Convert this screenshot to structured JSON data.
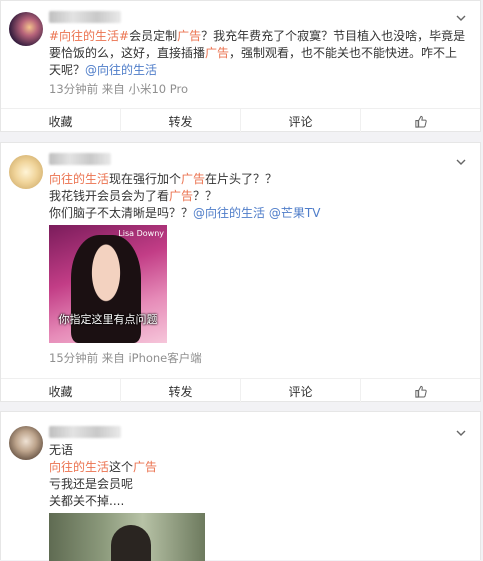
{
  "posts": [
    {
      "lines": [
        [
          [
            "r",
            "#向往的生活#"
          ],
          [
            "t",
            "会员定制"
          ],
          [
            "r",
            "广告"
          ],
          [
            "t",
            "？我充年费充了个寂寞？节目植入也没啥，毕竟是"
          ]
        ],
        [
          [
            "t",
            "要恰饭的么，这好，直接插播"
          ],
          [
            "r",
            "广告"
          ],
          [
            "t",
            "，强制观看，也不能关也不能快进。咋不上"
          ]
        ],
        [
          [
            "t",
            "天呢？"
          ],
          [
            "b",
            "@向往的生活"
          ]
        ]
      ],
      "meta": "13分钟前  来自 小米10 Pro"
    },
    {
      "lines": [
        [
          [
            "r",
            "向往的生活"
          ],
          [
            "t",
            "现在强行加个"
          ],
          [
            "r",
            "广告"
          ],
          [
            "t",
            "在片头了？？"
          ]
        ],
        [
          [
            "t",
            "我花钱开会员会为了看"
          ],
          [
            "r",
            "广告"
          ],
          [
            "t",
            "？？"
          ]
        ],
        [
          [
            "t",
            "你们脑子不太清晰是吗？？"
          ],
          [
            "b",
            "@向往的生活"
          ],
          [
            "t",
            " "
          ],
          [
            "b",
            "@芒果TV"
          ]
        ]
      ],
      "image": {
        "overlay": "Lisa Downy",
        "caption": "你指定这里有点问题"
      },
      "meta": "15分钟前  来自 iPhone客户端"
    },
    {
      "lines": [
        [
          [
            "t",
            "无语"
          ]
        ],
        [
          [
            "r",
            "向往的生活"
          ],
          [
            "t",
            "这个"
          ],
          [
            "r",
            "广告"
          ]
        ],
        [
          [
            "t",
            "亏我还是会员呢"
          ]
        ],
        [
          [
            "t",
            "关都关不掉...."
          ]
        ]
      ]
    }
  ],
  "actions": {
    "collect": "收藏",
    "repost": "转发",
    "comment": "评论"
  }
}
